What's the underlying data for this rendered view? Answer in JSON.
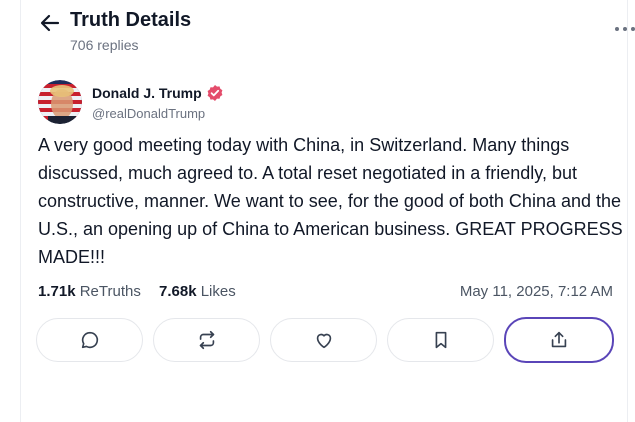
{
  "header": {
    "title": "Truth Details",
    "replies": "706 replies",
    "back_icon": "arrow-left-icon",
    "more_icon": "more-horizontal-icon"
  },
  "author": {
    "name": "Donald J. Trump",
    "handle": "@realDonaldTrump",
    "verified": true,
    "verified_color": "#e44c6b"
  },
  "post": {
    "text": "A very good meeting today with China, in Switzerland. Many things discussed, much agreed to. A total reset negotiated in a friendly, but constructive, manner. We want to see, for the good of both China and the U.S., an opening up of China to American business. GREAT PROGRESS MADE!!!"
  },
  "stats": {
    "retruths_count": "1.71k",
    "retruths_label": "ReTruths",
    "likes_count": "7.68k",
    "likes_label": "Likes",
    "timestamp": "May 11, 2025, 7:12 AM"
  },
  "actions": [
    {
      "name": "reply",
      "icon": "comment-icon"
    },
    {
      "name": "retruth",
      "icon": "repost-icon"
    },
    {
      "name": "like",
      "icon": "heart-icon"
    },
    {
      "name": "bookmark",
      "icon": "bookmark-icon"
    },
    {
      "name": "share",
      "icon": "share-icon",
      "active": true
    }
  ],
  "colors": {
    "accent": "#5a45b8",
    "text": "#111827",
    "muted": "#6b7280"
  }
}
